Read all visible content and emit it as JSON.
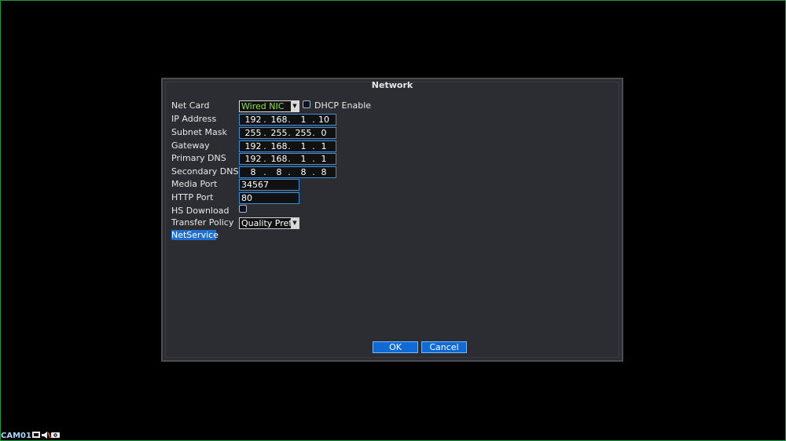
{
  "window": {
    "title": "Network"
  },
  "form": {
    "net_card_label": "Net Card",
    "net_card_value": "Wired NIC",
    "dhcp_label": "DHCP Enable",
    "ip_label": "IP Address",
    "ip": [
      "192",
      "168",
      "1",
      "10"
    ],
    "subnet_label": "Subnet Mask",
    "subnet": [
      "255",
      "255",
      "255",
      "0"
    ],
    "gateway_label": "Gateway",
    "gateway": [
      "192",
      "168",
      "1",
      "1"
    ],
    "primary_dns_label": "Primary DNS",
    "primary_dns": [
      "192",
      "168",
      "1",
      "1"
    ],
    "secondary_dns_label": "Secondary DNS",
    "secondary_dns": [
      "8",
      "8",
      "8",
      "8"
    ],
    "media_port_label": "Media Port",
    "media_port": "34567",
    "http_port_label": "HTTP Port",
    "http_port": "80",
    "hs_download_label": "HS Download",
    "transfer_policy_label": "Transfer Policy",
    "transfer_policy_value": "Quality Prefe"
  },
  "buttons": {
    "netservice": "NetService",
    "ok": "OK",
    "cancel": "Cancel"
  },
  "status": {
    "camera": "CAM01"
  },
  "icons": [
    "record-icon",
    "speaker-icon",
    "camera-icon"
  ]
}
